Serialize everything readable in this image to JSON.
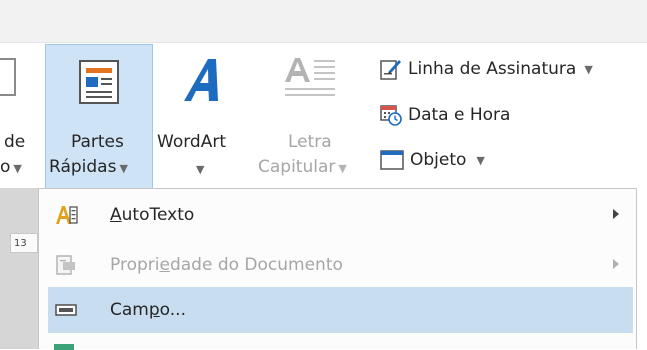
{
  "ribbon": {
    "left_partial": {
      "line1": "de",
      "line2": "o"
    },
    "partes": {
      "line1": "Partes",
      "line2": "Rápidas"
    },
    "wordart": {
      "label": "WordArt"
    },
    "letra": {
      "line1": "Letra",
      "line2": "Capitular"
    },
    "small_buttons": [
      {
        "label": "Linha de Assinatura",
        "icon": "signature-pen-icon"
      },
      {
        "label": "Data e Hora",
        "icon": "calendar-clock-icon"
      },
      {
        "label": "Objeto",
        "icon": "object-window-icon"
      }
    ]
  },
  "ruler": {
    "number": "13"
  },
  "menu": {
    "items": [
      {
        "before": "",
        "underline": "A",
        "after": "utoTexto",
        "enabled": true,
        "has_submenu": true,
        "highlighted": false,
        "icon": "autotext-icon"
      },
      {
        "before": "Propri",
        "underline": "e",
        "after": "dade do Documento",
        "enabled": false,
        "has_submenu": true,
        "highlighted": false,
        "icon": "document-property-icon"
      },
      {
        "before": "Cam",
        "underline": "p",
        "after": "o...",
        "enabled": true,
        "has_submenu": false,
        "highlighted": true,
        "icon": "field-icon"
      }
    ]
  },
  "colors": {
    "highlight": "#c9ddf0",
    "accent": "#1e6cc0",
    "topbar": "#f2f2f2"
  }
}
